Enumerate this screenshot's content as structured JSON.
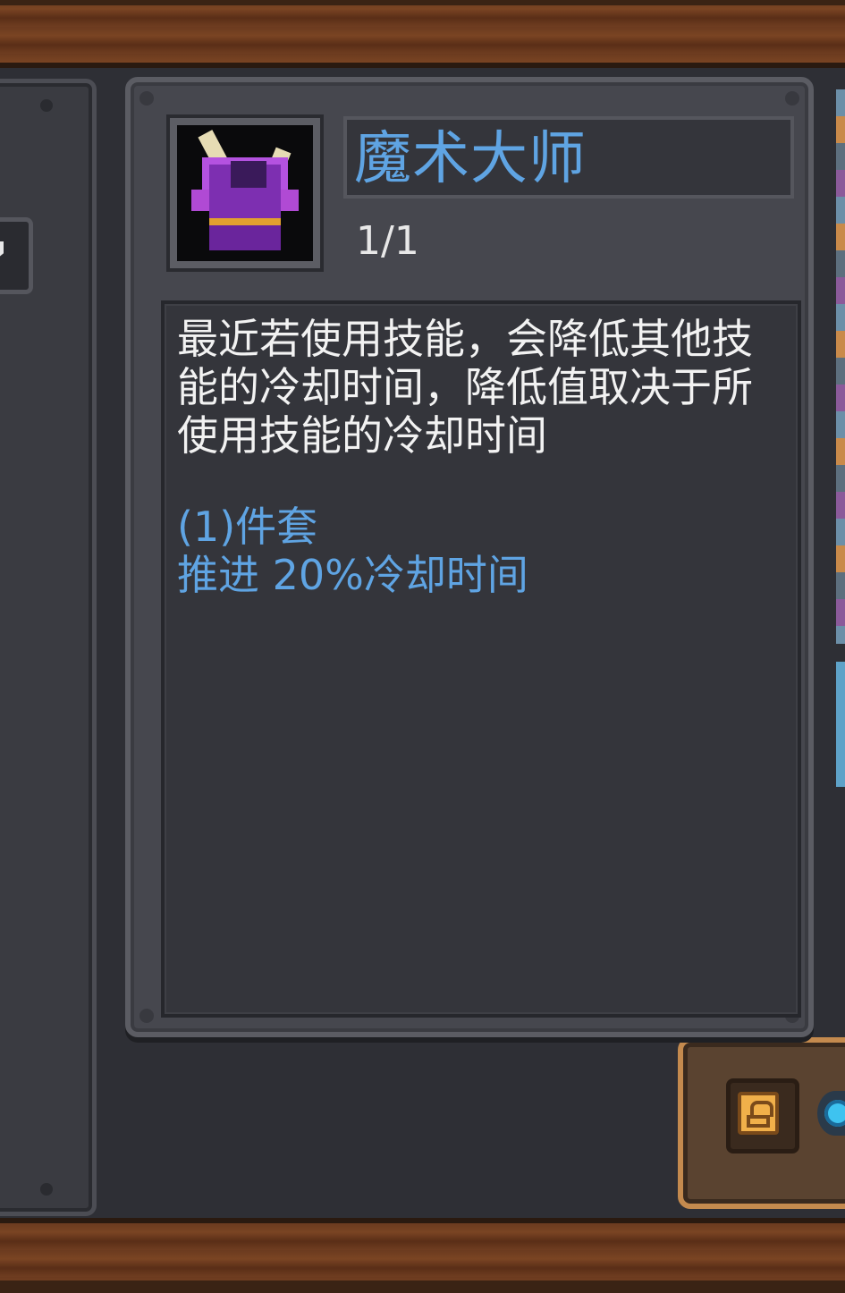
{
  "item": {
    "name": "魔术大师",
    "count": "1/1",
    "icon": "magic-hat-icon",
    "description": "最近若使用技能，会降低其他技能的冷却时间，降低值取决于所使用技能的冷却时间",
    "set_bonus": {
      "title": "(1)件套",
      "effect": "推进 20%冷却时间"
    }
  },
  "colors": {
    "accent_blue": "#5fa4e3",
    "panel": "#46474e",
    "text": "#f2f2f2",
    "lock_icon": "#f1b04a"
  },
  "icons": [
    "lock-icon",
    "gem-icon",
    "magic-hat-icon"
  ]
}
